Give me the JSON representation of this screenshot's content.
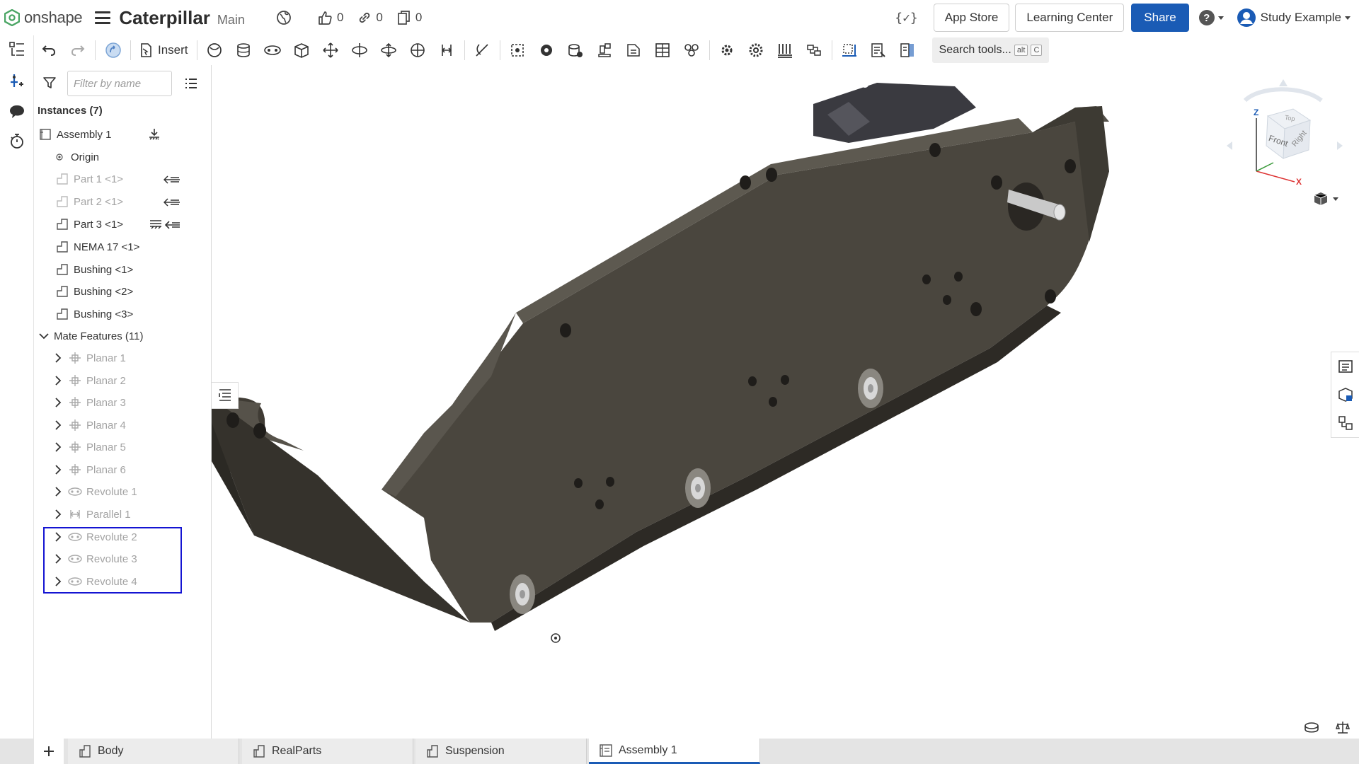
{
  "header": {
    "logo_text": "onshape",
    "doc_title": "Caterpillar",
    "branch": "Main",
    "likes": "0",
    "links": "0",
    "copies": "0",
    "app_store": "App Store",
    "learning_center": "Learning Center",
    "share": "Share",
    "user_name": "Study Example"
  },
  "toolbar": {
    "insert_label": "Insert",
    "search_placeholder": "Search tools...",
    "search_kbd_1": "alt",
    "search_kbd_2": "C"
  },
  "panel": {
    "filter_placeholder": "Filter by name",
    "instances_title": "Instances (7)",
    "instances": [
      {
        "label": "Assembly 1"
      },
      {
        "label": "Origin"
      },
      {
        "label": "Part 1 <1>"
      },
      {
        "label": "Part 2 <1>"
      },
      {
        "label": "Part 3 <1>"
      },
      {
        "label": "NEMA 17 <1>"
      },
      {
        "label": "Bushing <1>"
      },
      {
        "label": "Bushing <2>"
      },
      {
        "label": "Bushing <3>"
      }
    ],
    "mates_title": "Mate Features (11)",
    "mates": [
      {
        "label": "Planar 1"
      },
      {
        "label": "Planar 2"
      },
      {
        "label": "Planar 3"
      },
      {
        "label": "Planar 4"
      },
      {
        "label": "Planar 5"
      },
      {
        "label": "Planar 6"
      },
      {
        "label": "Revolute 1"
      },
      {
        "label": "Parallel 1"
      },
      {
        "label": "Revolute 2"
      },
      {
        "label": "Revolute 3"
      },
      {
        "label": "Revolute 4"
      }
    ]
  },
  "view_cube": {
    "front": "Front",
    "right": "Right",
    "top": "Top",
    "axis_x": "X",
    "axis_z": "Z"
  },
  "tabs": [
    {
      "label": "Body"
    },
    {
      "label": "RealParts"
    },
    {
      "label": "Suspension"
    },
    {
      "label": "Assembly 1"
    }
  ],
  "colors": {
    "brand": "#1a5bb5",
    "highlight": "#1414d2",
    "model_body": "#4a463e"
  }
}
